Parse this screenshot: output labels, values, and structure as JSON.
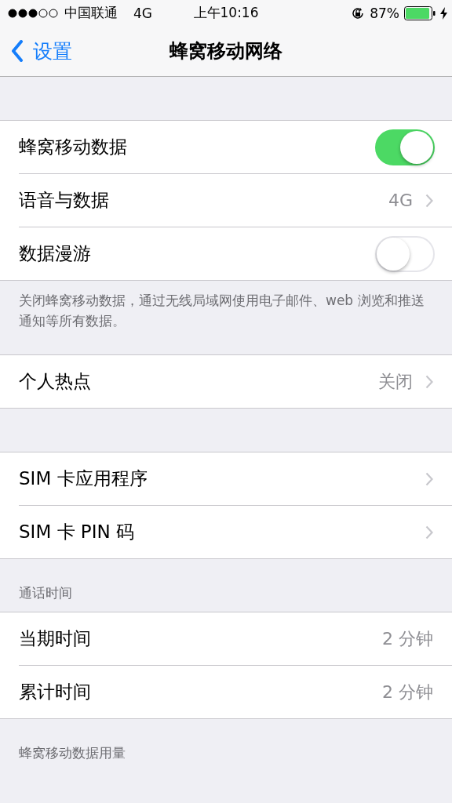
{
  "status_bar": {
    "carrier": "中国联通",
    "network": "4G",
    "time": "上午10:16",
    "battery": "87%"
  },
  "nav": {
    "back": "设置",
    "title": "蜂窝移动网络"
  },
  "groups": [
    {
      "rows": [
        {
          "kind": "toggle",
          "label": "蜂窝移动数据",
          "on": true
        },
        {
          "kind": "detail",
          "label": "语音与数据",
          "value": "4G"
        },
        {
          "kind": "toggle",
          "label": "数据漫游",
          "on": false
        }
      ],
      "footer": "关闭蜂窝移动数据，通过无线局域网使用电子邮件、web 浏览和推送通知等所有数据。"
    },
    {
      "rows": [
        {
          "kind": "detail",
          "label": "个人热点",
          "value": "关闭"
        }
      ]
    },
    {
      "rows": [
        {
          "kind": "detail",
          "label": "SIM 卡应用程序"
        },
        {
          "kind": "detail",
          "label": "SIM 卡 PIN 码"
        }
      ]
    },
    {
      "header": "通话时间",
      "rows": [
        {
          "kind": "value",
          "label": "当期时间",
          "value": "2 分钟"
        },
        {
          "kind": "value",
          "label": "累计时间",
          "value": "2 分钟"
        }
      ]
    },
    {
      "header": "蜂窝移动数据用量"
    }
  ]
}
